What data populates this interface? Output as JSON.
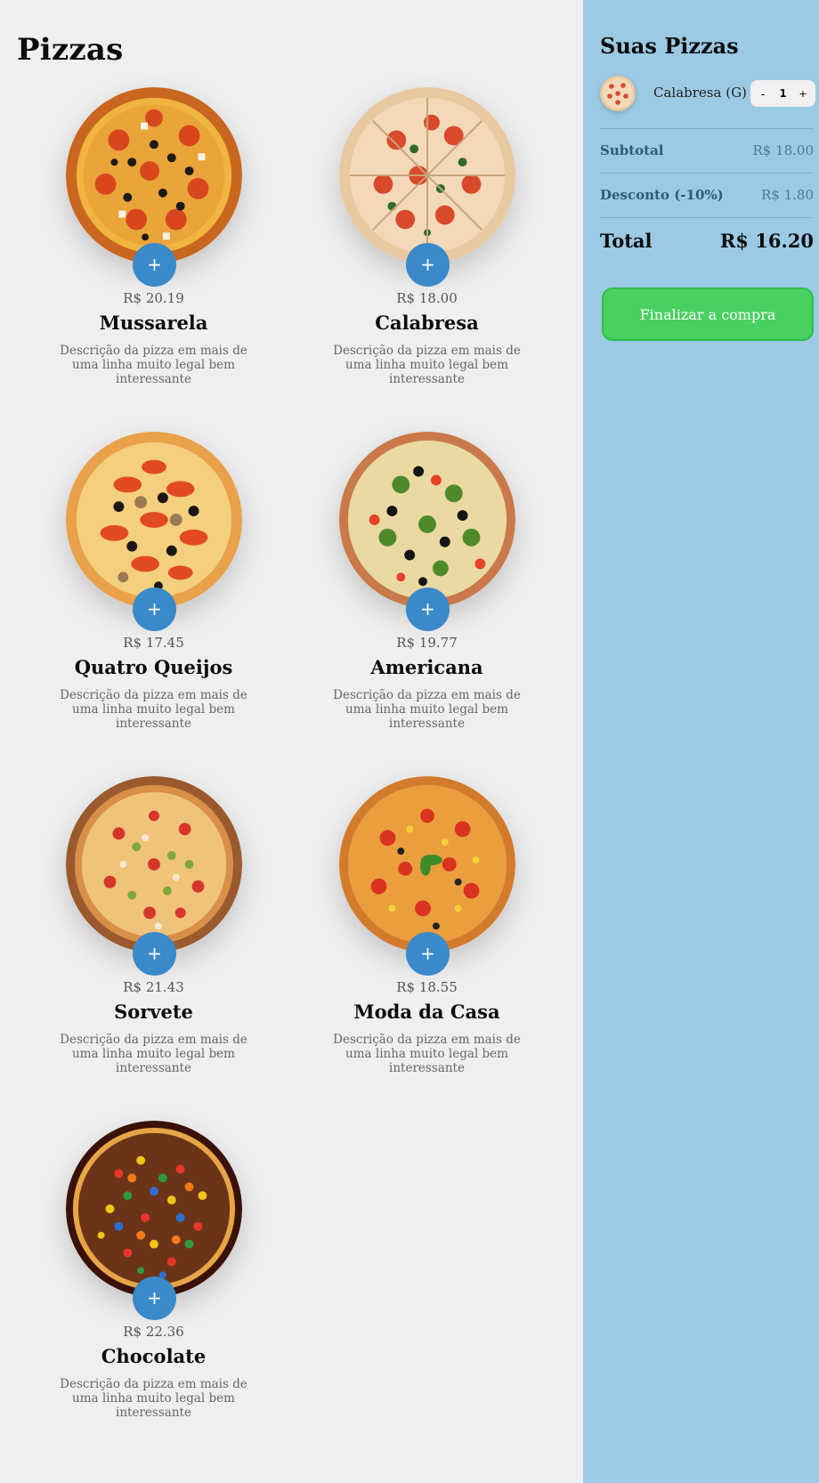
{
  "main": {
    "title": "Pizzas",
    "add_label": "+",
    "pizzas": [
      {
        "name": "Mussarela",
        "price": "R$ 20.19",
        "description": "Descrição da pizza em mais de uma linha muito legal bem interessante",
        "image": "pizza-mussarela"
      },
      {
        "name": "Calabresa",
        "price": "R$ 18.00",
        "description": "Descrição da pizza em mais de uma linha muito legal bem interessante",
        "image": "pizza-calabresa"
      },
      {
        "name": "Quatro Queijos",
        "price": "R$ 17.45",
        "description": "Descrição da pizza em mais de uma linha muito legal bem interessante",
        "image": "pizza-quatro-queijos"
      },
      {
        "name": "Americana",
        "price": "R$ 19.77",
        "description": "Descrição da pizza em mais de uma linha muito legal bem interessante",
        "image": "pizza-americana"
      },
      {
        "name": "Sorvete",
        "price": "R$ 21.43",
        "description": "Descrição da pizza em mais de uma linha muito legal bem interessante",
        "image": "pizza-sorvete"
      },
      {
        "name": "Moda da Casa",
        "price": "R$ 18.55",
        "description": "Descrição da pizza em mais de uma linha muito legal bem interessante",
        "image": "pizza-moda-da-casa"
      },
      {
        "name": "Chocolate",
        "price": "R$ 22.36",
        "description": "Descrição da pizza em mais de uma linha muito legal bem interessante",
        "image": "pizza-chocolate"
      }
    ]
  },
  "cart": {
    "title": "Suas Pizzas",
    "items": [
      {
        "name": "Calabresa (G)",
        "quantity": "1",
        "minus_label": "-",
        "plus_label": "+",
        "image": "pizza-calabresa"
      }
    ],
    "subtotal_label": "Subtotal",
    "subtotal_value": "R$ 18.00",
    "discount_label": "Desconto (-10%)",
    "discount_value": "R$ 1.80",
    "total_label": "Total",
    "total_value": "R$ 16.20",
    "checkout_label": "Finalizar a compra"
  },
  "colors": {
    "background": "#efefef",
    "sidebar": "#9ccae4",
    "add_button": "#3a89c9",
    "checkout_button": "#48d060"
  }
}
